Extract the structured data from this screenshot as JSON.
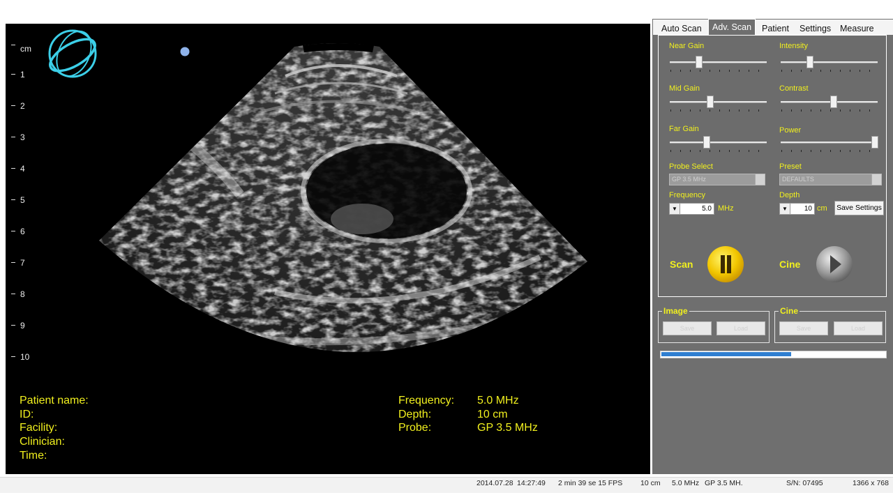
{
  "ruler": {
    "unit": "cm",
    "labels": [
      "1",
      "2",
      "3",
      "4",
      "5",
      "6",
      "7",
      "8",
      "9",
      "10"
    ]
  },
  "tabs": [
    {
      "label": "Auto Scan",
      "active": false
    },
    {
      "label": "Adv. Scan",
      "active": true
    },
    {
      "label": "Patient",
      "active": false
    },
    {
      "label": "Settings",
      "active": false
    },
    {
      "label": "Measure",
      "active": false
    }
  ],
  "controls": {
    "near_gain": {
      "label": "Near Gain",
      "value": 0.3
    },
    "intensity": {
      "label": "Intensity",
      "value": 0.3
    },
    "mid_gain": {
      "label": "Mid Gain",
      "value": 0.42
    },
    "contrast": {
      "label": "Contrast",
      "value": 0.55
    },
    "far_gain": {
      "label": "Far Gain",
      "value": 0.38
    },
    "power": {
      "label": "Power",
      "value": 0.97
    },
    "probe_select": {
      "label": "Probe Select",
      "value": "GP 3.5 MHz"
    },
    "preset": {
      "label": "Preset",
      "value": "DEFAULTS"
    },
    "frequency": {
      "label": "Frequency",
      "value": "5.0",
      "unit": "MHz"
    },
    "depth": {
      "label": "Depth",
      "value": "10",
      "unit": "cm"
    },
    "save_settings": "Save Settings",
    "scan_label": "Scan",
    "cine_label": "Cine"
  },
  "image_group": {
    "title": "Image",
    "save": "Save",
    "load": "Load"
  },
  "cine_group": {
    "title": "Cine",
    "save": "Save",
    "load": "Load"
  },
  "progress": 0.58,
  "info": {
    "patient_name_label": "Patient name:",
    "id_label": "ID:",
    "facility_label": "Facility:",
    "clinician_label": "Clinician:",
    "time_label": "Time:",
    "frequency_label": "Frequency:",
    "frequency_value": "5.0 MHz",
    "depth_label": "Depth:",
    "depth_value": "10 cm",
    "probe_label": "Probe:",
    "probe_value": "GP 3.5 MHz"
  },
  "status": {
    "date": "2014.07.28",
    "time": "14:27:49",
    "duration": "2 min 39 se 15 FPS",
    "depth": "10 cm",
    "frequency": "5.0 MHz",
    "probe": "GP 3.5 MH.",
    "serial": "S/N: 07495",
    "resolution": "1366 x 768"
  },
  "colors": {
    "accent_yellow": "#f1f01e",
    "progress_blue": "#2f7fd1",
    "logo_cyan": "#3ccfe8"
  }
}
